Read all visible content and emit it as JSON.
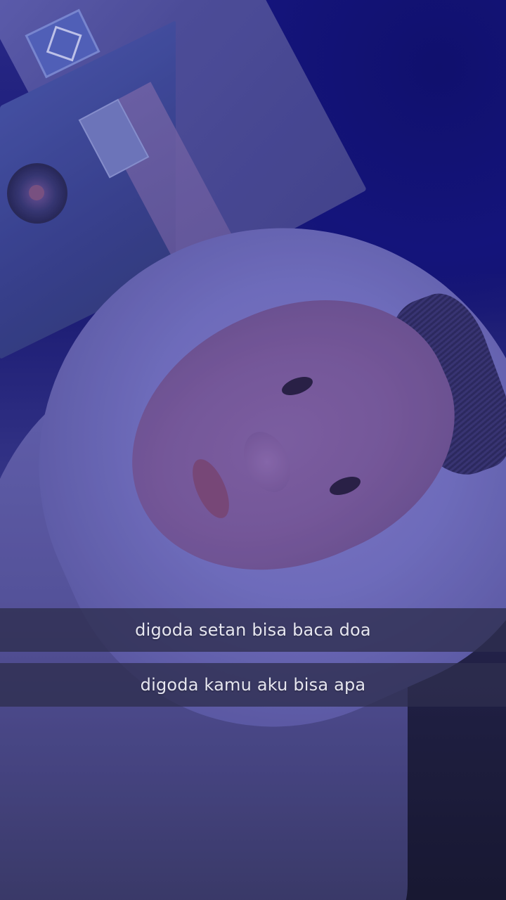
{
  "captions": {
    "line1": "digoda setan bisa baca doa",
    "line2": "digoda kamu aku bisa apa"
  },
  "colors": {
    "tint": "#2a2a8a",
    "caption_bar": "#2e2e4e",
    "caption_text": "#e6e6f0"
  }
}
